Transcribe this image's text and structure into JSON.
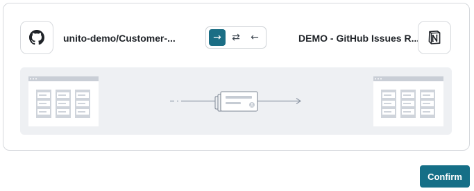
{
  "source": {
    "project_name": "unito-demo/Customer-...",
    "icon": "github-icon"
  },
  "target": {
    "project_name": "DEMO - GitHub Issues R...",
    "icon": "notion-icon"
  },
  "direction": {
    "options": [
      {
        "glyph": "→",
        "name": "one-way-right",
        "selected": true
      },
      {
        "glyph": "⇄",
        "name": "two-way",
        "selected": false
      },
      {
        "glyph": "←",
        "name": "one-way-left",
        "selected": false
      }
    ]
  },
  "actions": {
    "confirm_label": "Confirm"
  },
  "colors": {
    "accent": "#156f87",
    "diagram_bg": "#eef0f3"
  }
}
